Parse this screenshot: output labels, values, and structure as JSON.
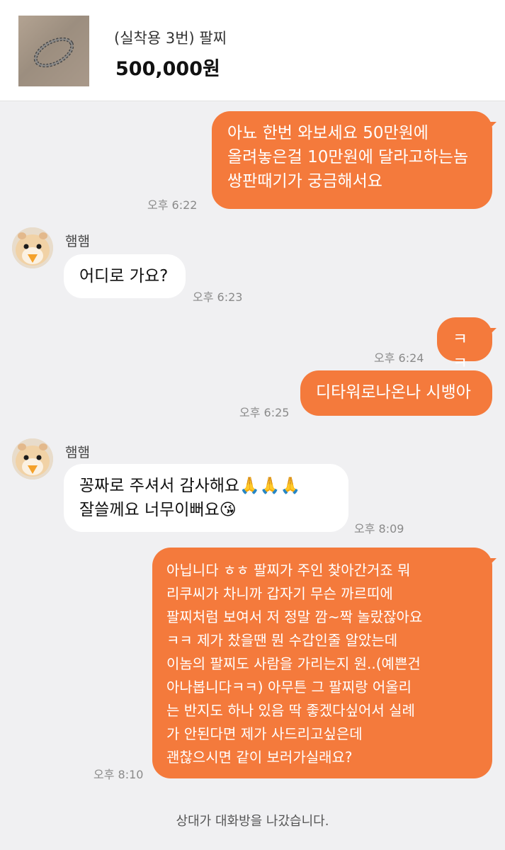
{
  "product": {
    "title": "(실착용 3번) 팔찌",
    "price": "500,000원"
  },
  "messages": [
    {
      "text": "아뇨 한번 와보세요 50만원에\n올려놓은걸 10만원에 달라고하는놈\n쌍판때기가 궁금해서요",
      "time": "오후 6:22"
    },
    {
      "sender": "햄햄",
      "text": "어디로 가요?",
      "time": "오후 6:23"
    },
    {
      "text": "ㅋㅋ",
      "time": "오후 6:24"
    },
    {
      "text": "디타워로나온나 시뱅아",
      "time": "오후 6:25"
    },
    {
      "sender": "햄햄",
      "text": "꽁짜로 주셔서 감사해요🙏🙏🙏\n잘쓸께요 너무이뻐요😘",
      "time": "오후 8:09"
    },
    {
      "text": "아닙니다 ㅎㅎ 팔찌가 주인 찾아간거죠 뭐\n리쿠씨가 차니까 갑자기 무슨 까르띠에\n팔찌처럼 보여서 저 정말 깜~짝 놀랐잖아요\nㅋㅋ 제가 찼을땐 뭔 수갑인줄 알았는데\n이놈의 팔찌도 사람을 가리는지 원..(예쁜건\n아나봅니다ㅋㅋ) 아무튼 그 팔찌랑 어울리\n는 반지도 하나 있음 딱 좋겠다싶어서 실례\n가 안된다면 제가 사드리고싶은데\n괜찮으시면 같이 보러가실래요?",
      "time": "오후 8:10"
    }
  ],
  "system_message": "상대가 대화방을 나갔습니다.",
  "colors": {
    "my_bubble": "#f47a3c",
    "their_bubble": "#ffffff",
    "background": "#f0f0f2"
  },
  "icons": {
    "product_thumbnail": "bracelet-photo",
    "avatar": "hamster-avatar"
  }
}
